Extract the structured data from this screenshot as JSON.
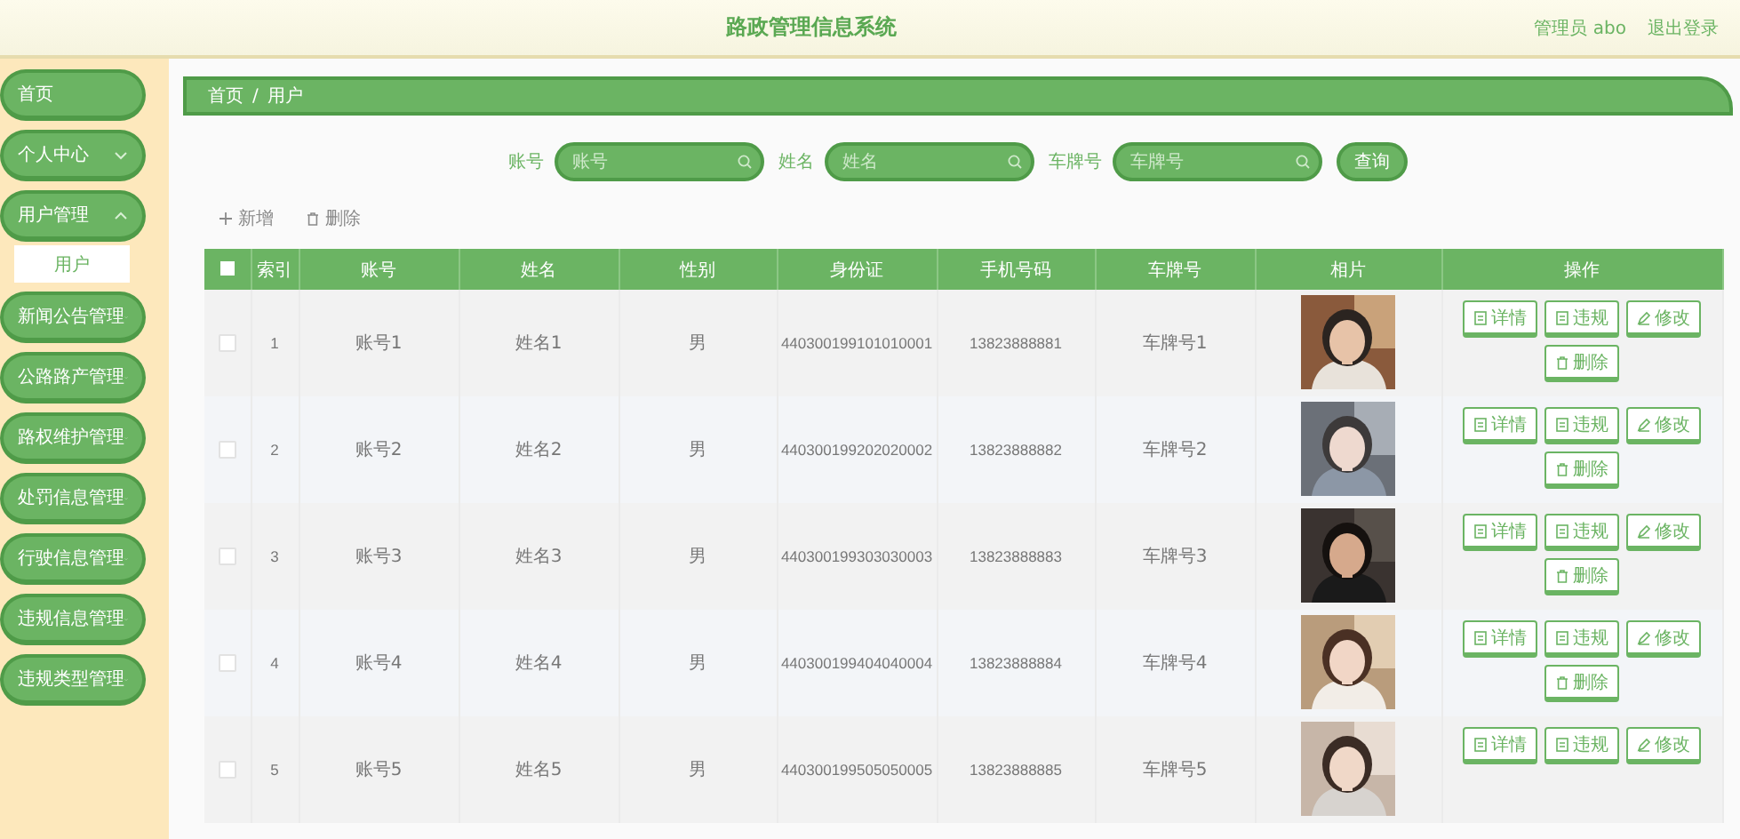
{
  "header": {
    "title": "路政管理信息系统",
    "user": "管理员 abo",
    "logout": "退出登录"
  },
  "sidebar": {
    "items": [
      {
        "label": "首页",
        "kind": "link"
      },
      {
        "label": "个人中心",
        "kind": "menu",
        "expanded": false
      },
      {
        "label": "用户管理",
        "kind": "menu",
        "expanded": true,
        "children": [
          {
            "label": "用户"
          }
        ]
      },
      {
        "label": "新闻公告管理",
        "kind": "menu",
        "expanded": false
      },
      {
        "label": "公路路产管理",
        "kind": "menu",
        "expanded": false
      },
      {
        "label": "路权维护管理",
        "kind": "menu",
        "expanded": false
      },
      {
        "label": "处罚信息管理",
        "kind": "menu",
        "expanded": false
      },
      {
        "label": "行驶信息管理",
        "kind": "menu",
        "expanded": false
      },
      {
        "label": "违规信息管理",
        "kind": "menu",
        "expanded": false
      },
      {
        "label": "违规类型管理",
        "kind": "menu",
        "expanded": false
      }
    ]
  },
  "breadcrumb": {
    "items": [
      "首页",
      "用户"
    ],
    "separator": "/"
  },
  "search": {
    "fields": [
      {
        "label": "账号",
        "placeholder": "账号"
      },
      {
        "label": "姓名",
        "placeholder": "姓名"
      },
      {
        "label": "车牌号",
        "placeholder": "车牌号"
      }
    ],
    "button": "查询"
  },
  "actions": [
    {
      "kind": "add",
      "label": "新增"
    },
    {
      "kind": "delete",
      "label": "删除"
    }
  ],
  "table": {
    "select_all_checked": false,
    "columns": [
      "索引",
      "账号",
      "姓名",
      "性别",
      "身份证",
      "手机号码",
      "车牌号",
      "相片",
      "操作"
    ],
    "rows": [
      {
        "checked": false,
        "index": "1",
        "account": "账号1",
        "name": "姓名1",
        "gender": "男",
        "id_card": "440300199101010001",
        "phone": "13823888881",
        "plate": "车牌号1",
        "photo": {
          "kind": "picture"
        },
        "buttons": [
          {
            "kind": "detail",
            "label": "详情"
          },
          {
            "kind": "violation",
            "label": "违规"
          },
          {
            "kind": "edit",
            "label": "修改"
          },
          {
            "kind": "delete",
            "label": "删除"
          }
        ]
      },
      {
        "checked": false,
        "index": "2",
        "account": "账号2",
        "name": "姓名2",
        "gender": "男",
        "id_card": "440300199202020002",
        "phone": "13823888882",
        "plate": "车牌号2",
        "photo": {
          "kind": "picture"
        },
        "buttons": [
          {
            "kind": "detail",
            "label": "详情"
          },
          {
            "kind": "violation",
            "label": "违规"
          },
          {
            "kind": "edit",
            "label": "修改"
          },
          {
            "kind": "delete",
            "label": "删除"
          }
        ]
      },
      {
        "checked": false,
        "index": "3",
        "account": "账号3",
        "name": "姓名3",
        "gender": "男",
        "id_card": "440300199303030003",
        "phone": "13823888883",
        "plate": "车牌号3",
        "photo": {
          "kind": "picture"
        },
        "buttons": [
          {
            "kind": "detail",
            "label": "详情"
          },
          {
            "kind": "violation",
            "label": "违规"
          },
          {
            "kind": "edit",
            "label": "修改"
          },
          {
            "kind": "delete",
            "label": "删除"
          }
        ]
      },
      {
        "checked": false,
        "index": "4",
        "account": "账号4",
        "name": "姓名4",
        "gender": "男",
        "id_card": "440300199404040004",
        "phone": "13823888884",
        "plate": "车牌号4",
        "photo": {
          "kind": "picture"
        },
        "buttons": [
          {
            "kind": "detail",
            "label": "详情"
          },
          {
            "kind": "violation",
            "label": "违规"
          },
          {
            "kind": "edit",
            "label": "修改"
          },
          {
            "kind": "delete",
            "label": "删除"
          }
        ]
      },
      {
        "checked": false,
        "index": "5",
        "account": "账号5",
        "name": "姓名5",
        "gender": "男",
        "id_card": "440300199505050005",
        "phone": "13823888885",
        "plate": "车牌号5",
        "photo": {
          "kind": "picture"
        },
        "buttons": [
          {
            "kind": "detail",
            "label": "详情"
          },
          {
            "kind": "violation",
            "label": "违规"
          },
          {
            "kind": "edit",
            "label": "修改"
          }
        ]
      }
    ]
  }
}
